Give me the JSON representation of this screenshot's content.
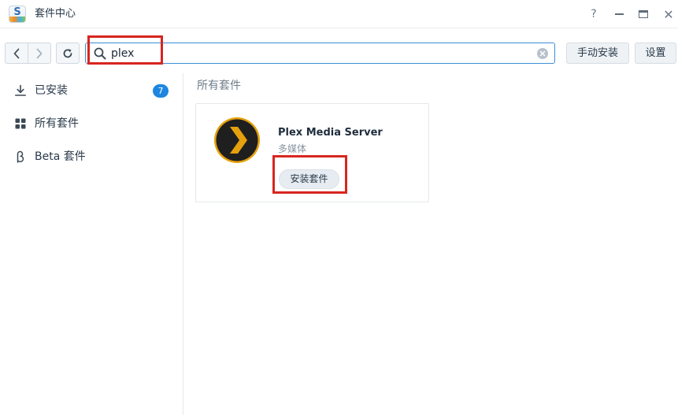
{
  "window": {
    "title": "套件中心",
    "app_icon_letter": "S",
    "help_label": "?",
    "close_label": "✕"
  },
  "toolbar": {
    "search_value": "plex",
    "manual_install_label": "手动安装",
    "settings_label": "设置"
  },
  "sidebar": {
    "items": [
      {
        "label": "已安装",
        "icon": "download-icon",
        "badge": "7"
      },
      {
        "label": "所有套件",
        "icon": "grid-icon"
      },
      {
        "label": "Beta 套件",
        "icon": "beta-icon"
      }
    ]
  },
  "main": {
    "section_title": "所有套件",
    "package": {
      "name": "Plex Media Server",
      "category": "多媒体",
      "install_label": "安装套件",
      "logo": "plex-logo",
      "logo_colors": {
        "ring": "#e5a00d",
        "fill": "#1f1f1f"
      }
    }
  },
  "colors": {
    "accent": "#3d8fd6",
    "badge": "#1e86e0",
    "highlight": "#d7261f"
  }
}
